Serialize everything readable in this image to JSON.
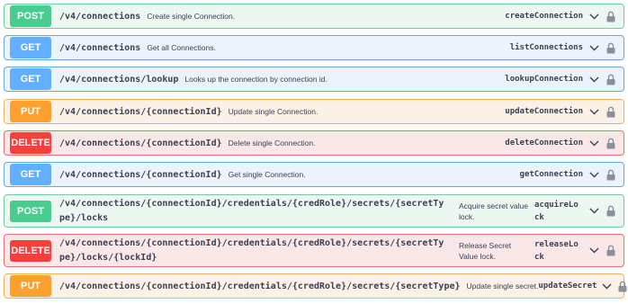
{
  "operations": [
    {
      "method": "POST",
      "path": "/v4/connections",
      "summary": "Create single Connection.",
      "operation_id": "createConnection",
      "chevron_icon": "chevron-down-icon",
      "lock_icon": "lock-icon"
    },
    {
      "method": "GET",
      "path": "/v4/connections",
      "summary": "Get all Connections.",
      "operation_id": "listConnections",
      "chevron_icon": "chevron-down-icon",
      "lock_icon": "lock-icon"
    },
    {
      "method": "GET",
      "path": "/v4/connections/lookup",
      "summary": "Looks up the connection by connection id.",
      "operation_id": "lookupConnection",
      "chevron_icon": "chevron-down-icon",
      "lock_icon": "lock-icon"
    },
    {
      "method": "PUT",
      "path": "/v4/connections/{connectionId}",
      "summary": "Update single Connection.",
      "operation_id": "updateConnection",
      "chevron_icon": "chevron-down-icon",
      "lock_icon": "lock-icon"
    },
    {
      "method": "DELETE",
      "path": "/v4/connections/{connectionId}",
      "summary": "Delete single Connection.",
      "operation_id": "deleteConnection",
      "chevron_icon": "chevron-down-icon",
      "lock_icon": "lock-icon"
    },
    {
      "method": "GET",
      "path": "/v4/connections/{connectionId}",
      "summary": "Get single Connection.",
      "operation_id": "getConnection",
      "chevron_icon": "chevron-down-icon",
      "lock_icon": "lock-icon"
    },
    {
      "method": "POST",
      "path": "/v4/connections/{connectionId}/credentials/{credRole}/secrets/{secretType}/locks",
      "summary": "Acquire secret value lock.",
      "operation_id": "acquireLock",
      "chevron_icon": "chevron-down-icon",
      "lock_icon": "lock-icon"
    },
    {
      "method": "DELETE",
      "path": "/v4/connections/{connectionId}/credentials/{credRole}/secrets/{secretType}/locks/{lockId}",
      "summary": "Release Secret Value lock.",
      "operation_id": "releaseLock",
      "chevron_icon": "chevron-down-icon",
      "lock_icon": "lock-icon"
    },
    {
      "method": "PUT",
      "path": "/v4/connections/{connectionId}/credentials/{credRole}/secrets/{secretType}",
      "summary": "Update single secret.",
      "operation_id": "updateSecret",
      "chevron_icon": "chevron-down-icon",
      "lock_icon": "lock-icon"
    }
  ],
  "colors": {
    "post": "#49cc90",
    "get": "#61affe",
    "put": "#fca130",
    "delete": "#f93e3e"
  }
}
